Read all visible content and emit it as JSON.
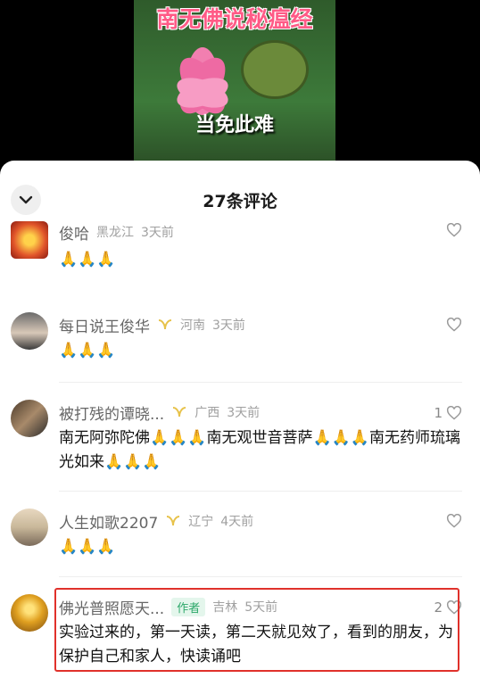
{
  "video": {
    "title_overlay": "南无佛说秘瘟经",
    "caption_overlay": "当免此难"
  },
  "sheet": {
    "title": "27条评论"
  },
  "comments": [
    {
      "name": "俊哈",
      "region": "黑龙江",
      "time": "3天前",
      "text": "🙏🙏🙏",
      "likes": ""
    },
    {
      "name": "每日说王俊华",
      "region": "河南",
      "time": "3天前",
      "text": "🙏🙏🙏",
      "likes": ""
    },
    {
      "name": "被打残的谭晓...",
      "region": "广西",
      "time": "3天前",
      "text": "南无阿弥陀佛🙏🙏🙏南无观世音菩萨🙏🙏🙏南无药师琉璃光如来🙏🙏🙏",
      "likes": "1"
    },
    {
      "name": "人生如歌2207",
      "region": "辽宁",
      "time": "4天前",
      "text": "🙏🙏🙏",
      "likes": ""
    },
    {
      "name": "佛光普照愿天...",
      "tag": "作者",
      "region": "吉林",
      "time": "5天前",
      "text": "实验过来的，第一天读，第二天就见效了，看到的朋友，为保护自己和家人，快读诵吧",
      "likes": "2"
    }
  ],
  "colors": {
    "highlight": "#e0312b",
    "author_tag": "#2da86a",
    "badge": "#e7c24a"
  }
}
